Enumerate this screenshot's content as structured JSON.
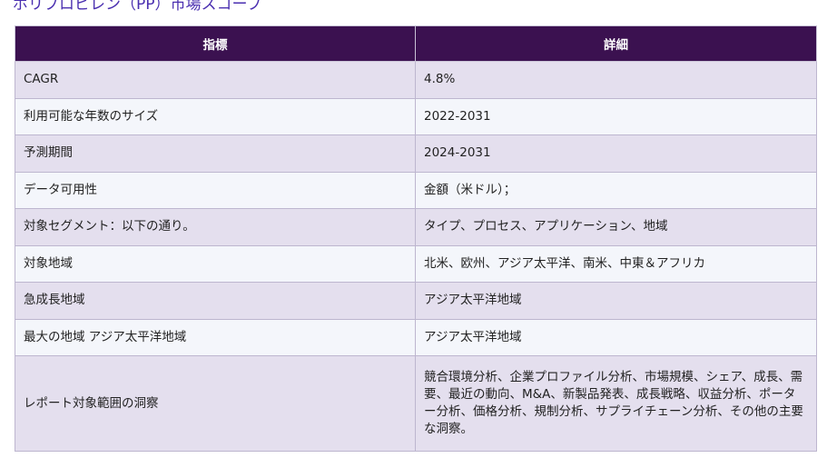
{
  "page": {
    "title": "ポリプロピレン（PP）市場スコープ"
  },
  "table": {
    "headers": [
      "指標",
      "詳細"
    ],
    "rows": [
      {
        "metric": "CAGR",
        "detail": "4.8%"
      },
      {
        "metric": "利用可能な年数のサイズ",
        "detail": "2022-2031"
      },
      {
        "metric": "予測期間",
        "detail": "2024-2031"
      },
      {
        "metric": "データ可用性",
        "detail": "金額（米ドル）；"
      },
      {
        "metric": "対象セグメント：以下の通り。",
        "detail": "タイプ、プロセス、アプリケーション、地域"
      },
      {
        "metric": "対象地域",
        "detail": "北米、欧州、アジア太平洋、南米、中東＆アフリカ"
      },
      {
        "metric": "急成長地域",
        "detail": "アジア太平洋地域"
      },
      {
        "metric": "最大の地域 アジア太平洋地域",
        "detail": "アジア太平洋地域"
      },
      {
        "metric": "レポート対象範囲の洞察",
        "detail": "競合環境分析、企業プロファイル分析、市場規模、シェア、成長、需要、最近の動向、M&A、新製品発表、成長戦略、収益分析、ポーター分析、価格分析、規制分析、サプライチェーン分析、その他の主要な洞察。"
      }
    ]
  },
  "colors": {
    "title": "#4a2fb0",
    "header_bg": "#3b1150",
    "row_odd": "#e4dfee",
    "row_even": "#f4f6fb"
  }
}
